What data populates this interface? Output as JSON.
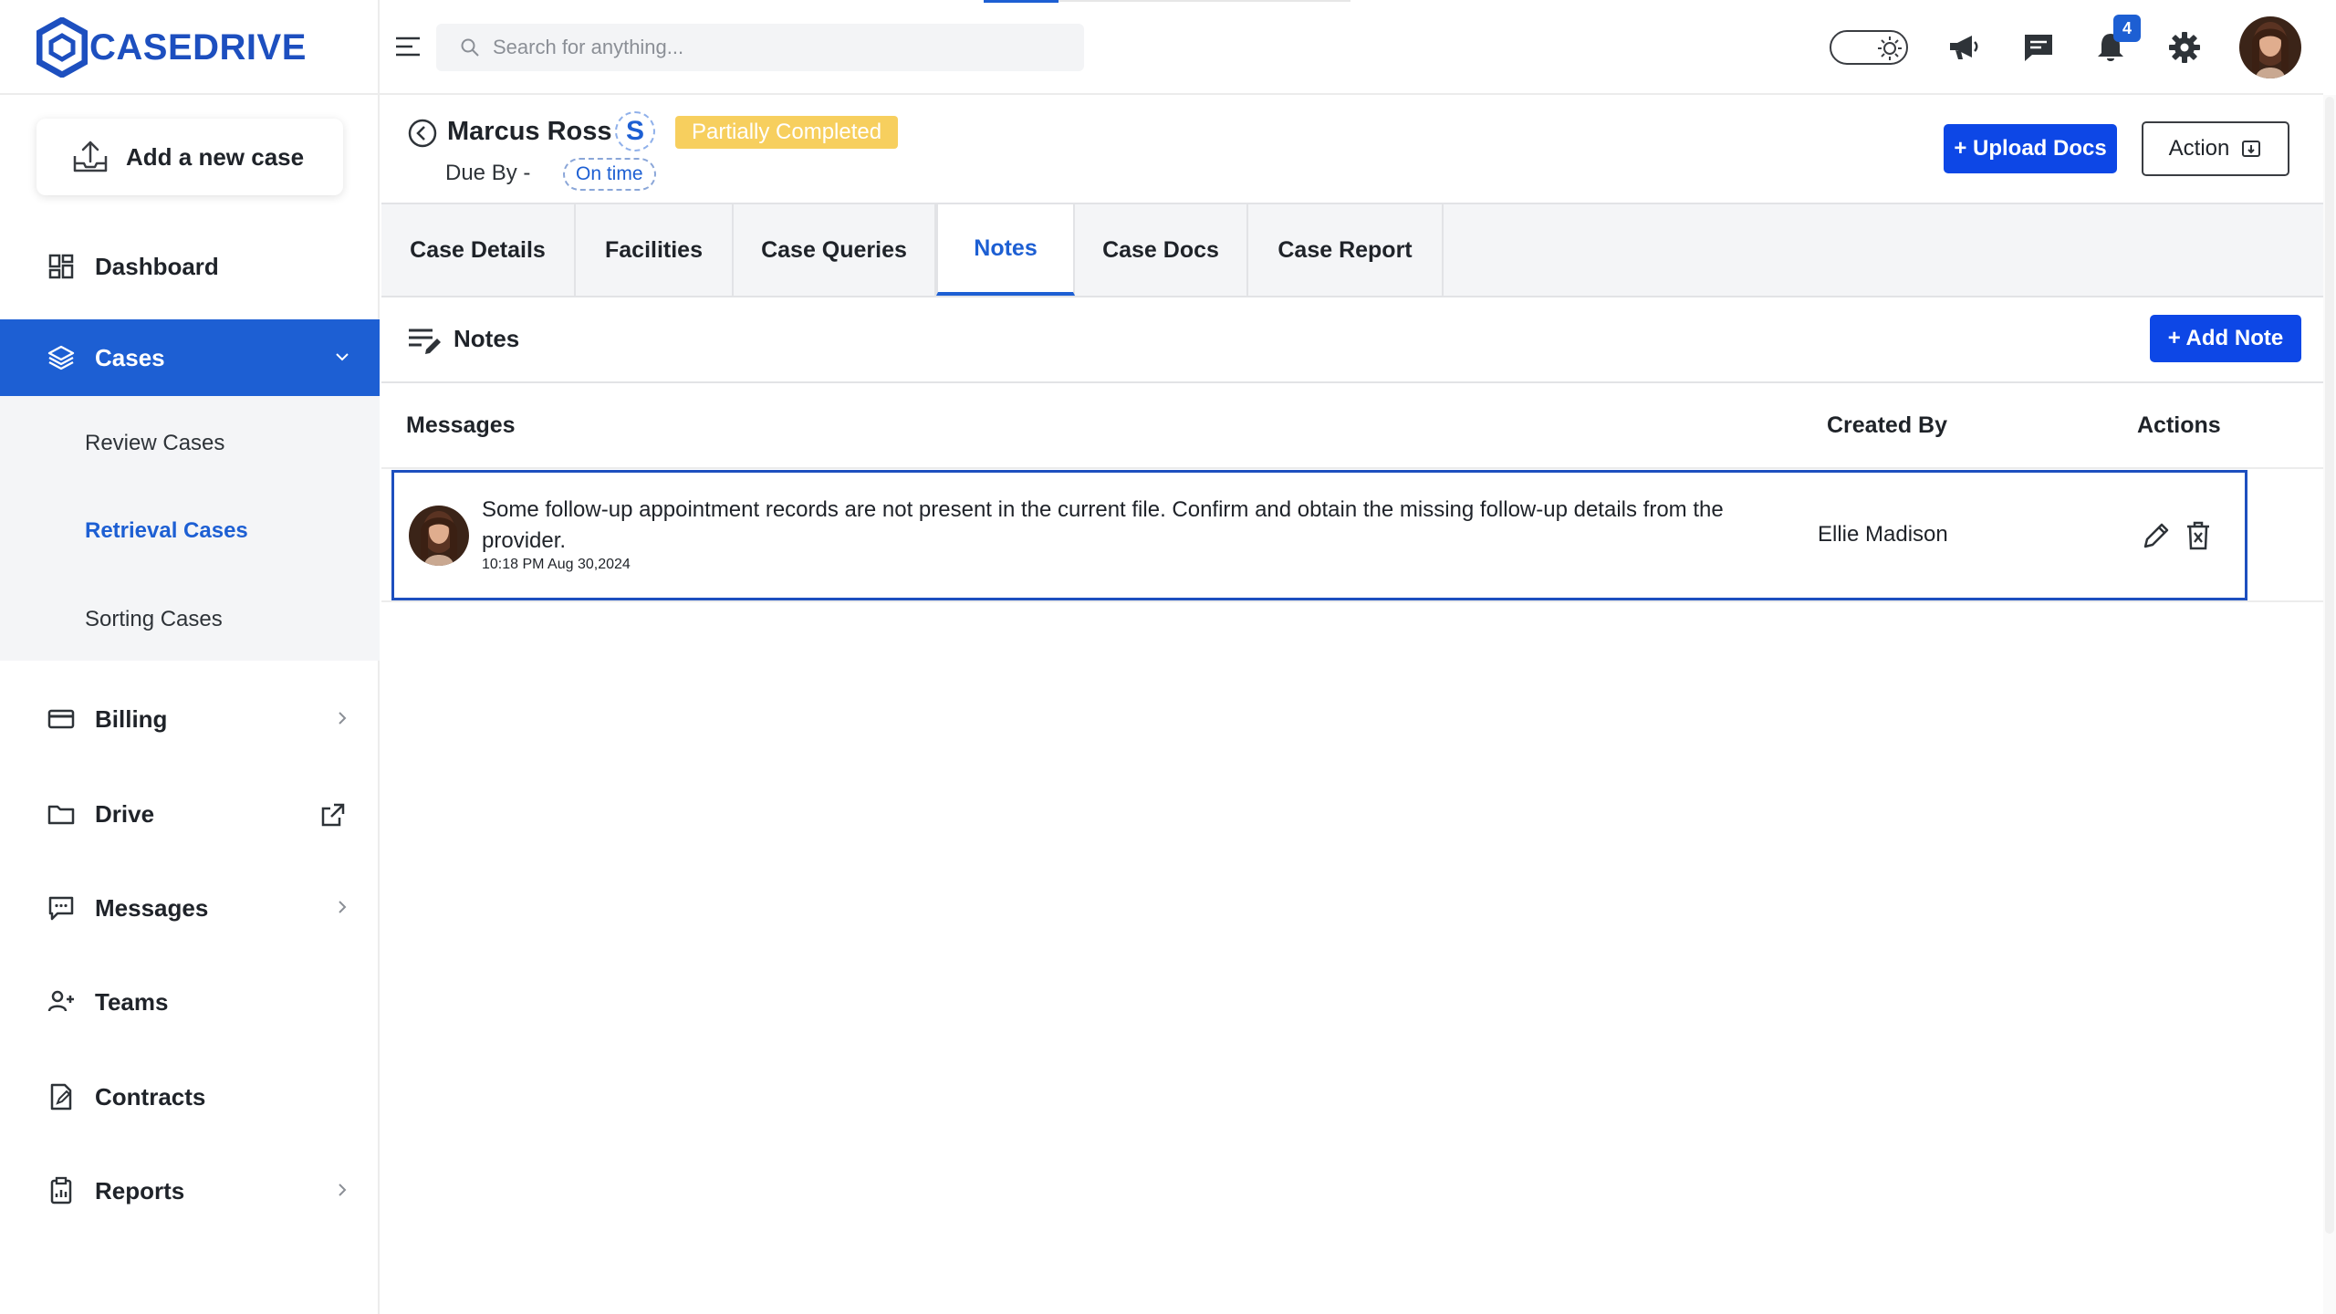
{
  "app": {
    "brand": "CASEDRIVE"
  },
  "sidebar": {
    "add_case_label": "Add a new case",
    "items": [
      {
        "label": "Dashboard"
      },
      {
        "label": "Cases"
      },
      {
        "label": "Billing"
      },
      {
        "label": "Drive"
      },
      {
        "label": "Messages"
      },
      {
        "label": "Teams"
      },
      {
        "label": "Contracts"
      },
      {
        "label": "Reports"
      }
    ],
    "cases_sub": [
      {
        "label": "Review Cases"
      },
      {
        "label": "Retrieval Cases"
      },
      {
        "label": "Sorting Cases"
      }
    ]
  },
  "header": {
    "search_placeholder": "Search for anything...",
    "notification_count": "4"
  },
  "case": {
    "name": "Marcus Ross",
    "initial": "S",
    "status": "Partially Completed",
    "due_label": "Due By -",
    "due_status": "On time",
    "upload_label": "+ Upload Docs",
    "action_label": "Action"
  },
  "tabs": [
    {
      "label": "Case Details"
    },
    {
      "label": "Facilities"
    },
    {
      "label": "Case Queries"
    },
    {
      "label": "Notes"
    },
    {
      "label": "Case Docs"
    },
    {
      "label": "Case Report"
    }
  ],
  "notes": {
    "title": "Notes",
    "add_label": "+ Add Note",
    "columns": {
      "messages": "Messages",
      "created_by": "Created By",
      "actions": "Actions"
    },
    "rows": [
      {
        "message": "Some follow-up appointment records are not present in the current file. Confirm and obtain the missing follow-up details from the provider.",
        "time": "10:18 PM Aug 30,2024",
        "created_by": "Ellie Madison"
      }
    ]
  },
  "colors": {
    "primary": "#1d5fd3",
    "button": "#0d47e6",
    "status_pill": "#f7cf5e"
  }
}
